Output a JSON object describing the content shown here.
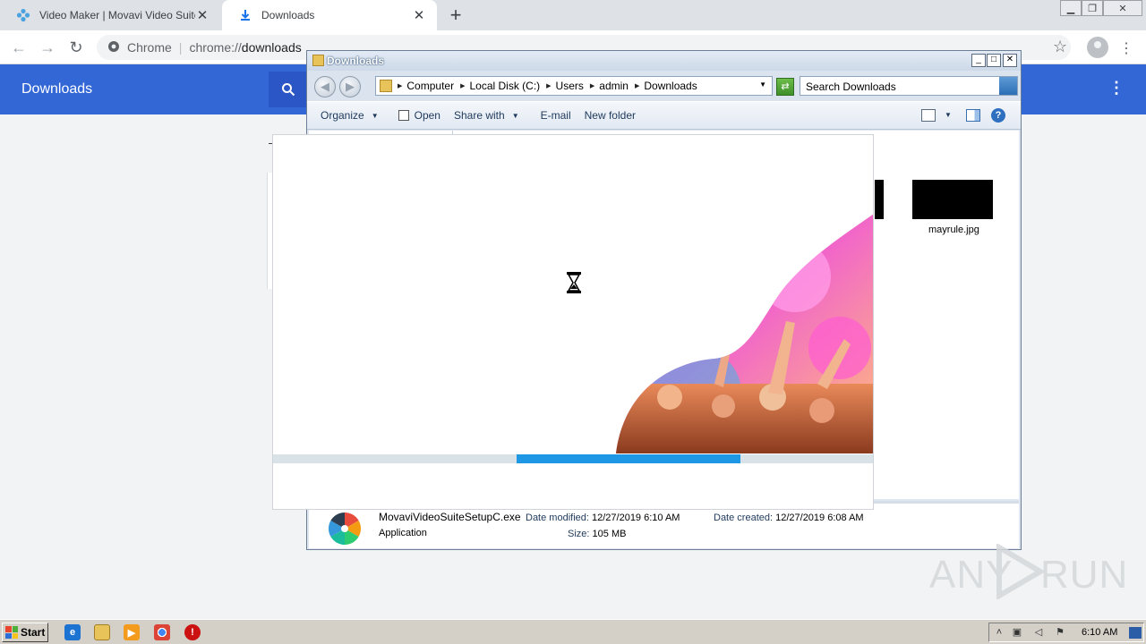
{
  "browser": {
    "tabs": [
      {
        "label": "Video Maker | Movavi Video Suite",
        "icon": "movavi-icon"
      },
      {
        "label": "Downloads",
        "icon": "download-icon"
      }
    ],
    "address": {
      "site_label": "Chrome",
      "scheme": "chrome://",
      "path": "downloads"
    }
  },
  "downloads_page": {
    "title": "Downloads"
  },
  "explorer": {
    "title": "Downloads",
    "breadcrumbs": [
      "Computer",
      "Local Disk (C:)",
      "Users",
      "admin",
      "Downloads"
    ],
    "search_placeholder": "Search Downloads",
    "toolbar": {
      "organize": "Organize",
      "open": "Open",
      "share_with": "Share with",
      "email": "E-mail",
      "new_folder": "New folder"
    },
    "files": [
      {
        "name": "mayrule.jpg"
      }
    ],
    "details": {
      "name": "MovaviVideoSuiteSetupC.exe",
      "type": "Application",
      "date_modified_label": "Date modified:",
      "date_modified": "12/27/2019 6:10 AM",
      "date_created_label": "Date created:",
      "date_created": "12/27/2019 6:08 AM",
      "size_label": "Size:",
      "size": "105 MB"
    }
  },
  "installer": {
    "progress_start": 0.405,
    "progress_end": 0.777,
    "progress_color": "#1e98e4"
  },
  "watermark": {
    "text_left": "ANY",
    "text_right": "RUN"
  },
  "taskbar": {
    "start_label": "Start",
    "clock": "6:10 AM"
  },
  "colors": {
    "chrome_header": "#3367d6",
    "explorer_frame": "#dfe6ef"
  }
}
